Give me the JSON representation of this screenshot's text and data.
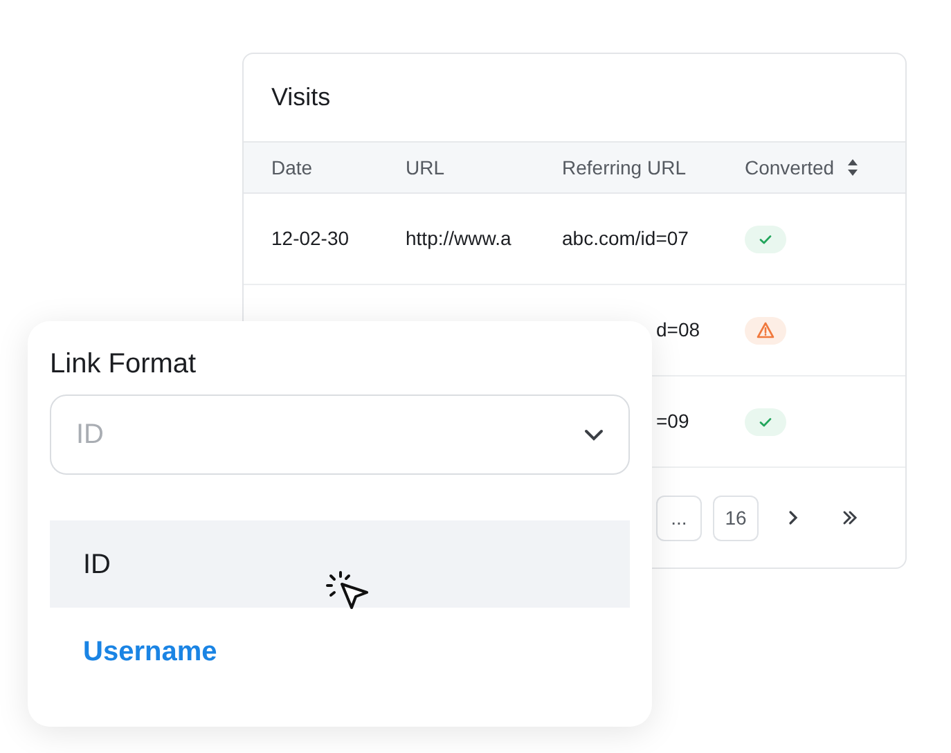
{
  "table": {
    "title": "Visits",
    "columns": [
      {
        "label": "Date",
        "sortable": false
      },
      {
        "label": "URL",
        "sortable": false
      },
      {
        "label": "Referring URL",
        "sortable": false
      },
      {
        "label": "Converted",
        "sortable": true
      }
    ],
    "rows": [
      {
        "date": "12-02-30",
        "url": "http://www.a",
        "referring_url": "abc.com/id=07",
        "kind": "success"
      },
      {
        "referring_url": "d=08",
        "kind": "warning"
      },
      {
        "referring_url": "=09",
        "kind": "success"
      }
    ]
  },
  "pagination": [
    {
      "label": "..."
    },
    {
      "label": "16"
    }
  ],
  "link_format": {
    "label": "Link Format",
    "placeholder": "ID",
    "options": [
      {
        "label": "ID",
        "hovered": true,
        "selected": false
      },
      {
        "label": "Username",
        "hovered": false,
        "selected": true
      }
    ]
  }
}
